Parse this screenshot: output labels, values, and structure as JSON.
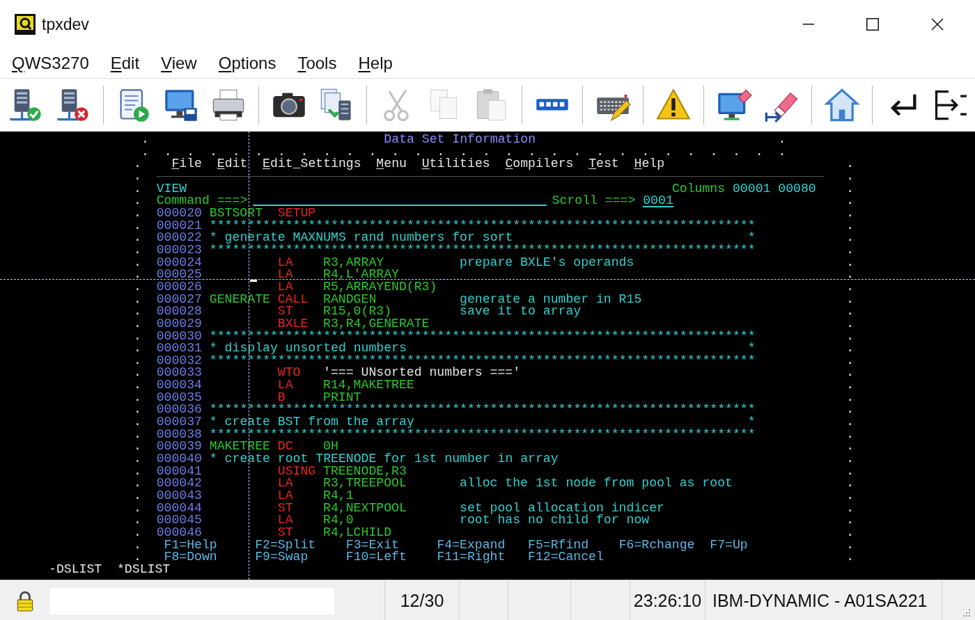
{
  "window": {
    "title": "tpxdev"
  },
  "menu": [
    {
      "mnemonic": "Q",
      "rest": "WS3270"
    },
    {
      "mnemonic": "E",
      "rest": "dit"
    },
    {
      "mnemonic": "V",
      "rest": "iew"
    },
    {
      "mnemonic": "O",
      "rest": "ptions"
    },
    {
      "mnemonic": "T",
      "rest": "ools"
    },
    {
      "mnemonic": "H",
      "rest": "elp"
    }
  ],
  "toolbar": [
    [
      {
        "kind": "server-ok",
        "disabled": false
      },
      {
        "kind": "server-x",
        "disabled": false
      }
    ],
    [
      {
        "kind": "script",
        "disabled": false
      },
      {
        "kind": "monitor-disk",
        "disabled": false
      },
      {
        "kind": "printer",
        "disabled": false
      }
    ],
    [
      {
        "kind": "camera",
        "disabled": false
      },
      {
        "kind": "transfer",
        "disabled": false
      }
    ],
    [
      {
        "kind": "scissors",
        "disabled": true
      },
      {
        "kind": "copy",
        "disabled": true
      },
      {
        "kind": "paste",
        "disabled": true
      }
    ],
    [
      {
        "kind": "keypad",
        "disabled": false
      }
    ],
    [
      {
        "kind": "keyboard",
        "disabled": false
      }
    ],
    [
      {
        "kind": "warning",
        "disabled": false
      }
    ],
    [
      {
        "kind": "monitor-eraser",
        "disabled": false
      },
      {
        "kind": "eraser-arrow",
        "disabled": false
      }
    ],
    [
      {
        "kind": "home",
        "disabled": false
      }
    ],
    [
      {
        "kind": "enter",
        "disabled": false
      },
      {
        "kind": "tab-back",
        "disabled": false
      }
    ]
  ],
  "terminal": {
    "panel_title": {
      "left": ".",
      "title": "Data Set Information",
      "right": "."
    },
    "dot_row": ".  .  .  .  .  .  .  .  .  .  .  .  .  .  .  .  .  .  .  .  .  .  .  .  .  .  .  .  .",
    "rows": [
      {
        "kind": "menu",
        "left": ".",
        "right": ".",
        "items": [
          {
            "mnemonic": "F",
            "rest": "ile"
          },
          {
            "mnemonic": "E",
            "rest": "dit"
          },
          {
            "mnemonic": "E",
            "rest": "dit_Settings"
          },
          {
            "mnemonic": "M",
            "rest": "enu"
          },
          {
            "mnemonic": "U",
            "rest": "tilities"
          },
          {
            "mnemonic": "C",
            "rest": "ompilers"
          },
          {
            "mnemonic": "T",
            "rest": "est"
          },
          {
            "mnemonic": "H",
            "rest": "elp"
          }
        ]
      },
      {
        "kind": "rule",
        "left": ".",
        "right": "."
      },
      {
        "kind": "mode",
        "left": ".",
        "right": ".",
        "mode": "VIEW",
        "columns_label": "Columns",
        "columns": "00001 00080"
      },
      {
        "kind": "command",
        "left": ".",
        "right": ".",
        "label": "Command ===>",
        "scroll_label": "Scroll ===>",
        "scroll": "0001"
      },
      {
        "kind": "stmt",
        "left": ".",
        "right": ".",
        "num": "000020",
        "label": "BSTSORT",
        "op": "SETUP"
      },
      {
        "kind": "stars",
        "left": ".",
        "right": ".",
        "num": "000021",
        "text": "************************************************************************"
      },
      {
        "kind": "boxed",
        "left": ".",
        "right": ".",
        "num": "000022",
        "text": "* generate MAXNUMS rand numbers for sort",
        "end": "*"
      },
      {
        "kind": "stars",
        "left": ".",
        "right": ".",
        "num": "000023",
        "text": "************************************************************************"
      },
      {
        "kind": "stmt",
        "left": ".",
        "right": ".",
        "num": "000024",
        "op": "LA",
        "args": "R3,ARRAY",
        "remark": "prepare BXLE's operands"
      },
      {
        "kind": "stmt",
        "left": ".",
        "right": ".",
        "num": "000025",
        "op": "LA",
        "args": "R4,L'ARRAY"
      },
      {
        "kind": "stmt",
        "left": ".",
        "right": ".",
        "num": "000026",
        "op": "LA",
        "args": "R5,ARRAYEND(R3)"
      },
      {
        "kind": "stmt",
        "left": ".",
        "right": ".",
        "num": "000027",
        "label": "GENERATE",
        "op": "CALL",
        "args": "RANDGEN",
        "remark": "generate a number in R15"
      },
      {
        "kind": "stmt",
        "left": ".",
        "right": ".",
        "num": "000028",
        "op": "ST",
        "args": "R15,0(R3)",
        "remark": "save it to array"
      },
      {
        "kind": "stmt",
        "left": ".",
        "right": ".",
        "num": "000029",
        "op": "BXLE",
        "args": "R3,R4,GENERATE"
      },
      {
        "kind": "stars",
        "left": ".",
        "right": ".",
        "num": "000030",
        "text": "************************************************************************"
      },
      {
        "kind": "boxed",
        "left": ".",
        "right": ".",
        "num": "000031",
        "text": "* display unsorted numbers",
        "end": "*"
      },
      {
        "kind": "stars",
        "left": ".",
        "right": ".",
        "num": "000032",
        "text": "************************************************************************"
      },
      {
        "kind": "stmt",
        "left": ".",
        "right": ".",
        "num": "000033",
        "op": "WTO",
        "string": "'=== UNsorted numbers ==='"
      },
      {
        "kind": "stmt",
        "left": ".",
        "right": ".",
        "num": "000034",
        "op": "LA",
        "args": "R14,MAKETREE"
      },
      {
        "kind": "stmt",
        "left": ".",
        "right": ".",
        "num": "000035",
        "op": "B",
        "args": "PRINT"
      },
      {
        "kind": "stars",
        "left": ".",
        "right": ".",
        "num": "000036",
        "text": "************************************************************************"
      },
      {
        "kind": "boxed",
        "left": ".",
        "right": ".",
        "num": "000037",
        "text": "* create BST from the array",
        "end": "*"
      },
      {
        "kind": "stars",
        "left": ".",
        "right": ".",
        "num": "000038",
        "text": "************************************************************************"
      },
      {
        "kind": "stmt",
        "left": ".",
        "right": ".",
        "num": "000039",
        "label": "MAKETREE",
        "op": "DC",
        "args": "0H"
      },
      {
        "kind": "note",
        "left": ".",
        "right": ".",
        "num": "000040",
        "text": "* create root TREENODE for 1st number in array"
      },
      {
        "kind": "stmt",
        "left": ".",
        "right": ".",
        "num": "000041",
        "op": "USING",
        "args": "TREENODE,R3"
      },
      {
        "kind": "stmt",
        "left": ".",
        "right": ".",
        "num": "000042",
        "op": "LA",
        "args": "R3,TREEPOOL",
        "remark": "alloc the 1st node from pool as root"
      },
      {
        "kind": "stmt",
        "left": ".",
        "right": ".",
        "num": "000043",
        "op": "LA",
        "args": "R4,1"
      },
      {
        "kind": "stmt",
        "left": ".",
        "right": ".",
        "num": "000044",
        "op": "ST",
        "args": "R4,NEXTPOOL",
        "remark": "set pool allocation indicer"
      },
      {
        "kind": "stmt",
        "left": ".",
        "right": ".",
        "num": "000045",
        "op": "LA",
        "args": "R4,0",
        "remark": "root has no child for now"
      },
      {
        "kind": "stmt",
        "left": ".",
        "right": ".",
        "num": "000046",
        "op": "ST",
        "args": "R4,LCHILD"
      },
      {
        "kind": "fkeys",
        "left": ".",
        "right": ".",
        "keys": [
          "F1=Help",
          "F2=Split",
          "F3=Exit",
          "F4=Expand",
          "F5=Rfind",
          "F6=Rchange",
          "F7=Up"
        ]
      },
      {
        "kind": "fkeys",
        "left": ".",
        "right": ".",
        "keys": [
          "F8=Down",
          "F9=Swap",
          "F10=Left",
          "F11=Right",
          "F12=Cancel"
        ]
      }
    ],
    "windows": [
      "-DSLIST",
      "*DSLIST"
    ]
  },
  "status_bar": {
    "locked": true,
    "position": "12/30",
    "time": "23:26:10",
    "session": "IBM-DYNAMIC - A01SA221"
  }
}
